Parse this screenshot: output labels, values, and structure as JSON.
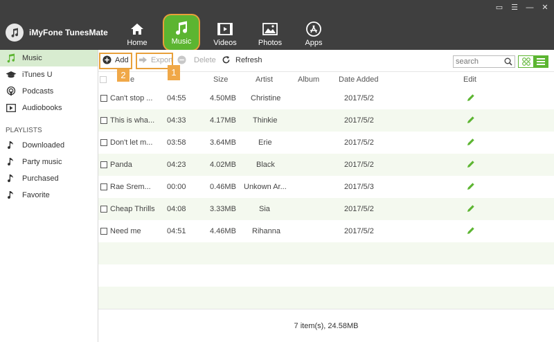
{
  "app": {
    "name": "iMyFone TunesMate"
  },
  "window_controls": {
    "feedback": "▭",
    "menu": "☰",
    "minimize": "—",
    "close": "✕"
  },
  "nav": {
    "tabs": [
      {
        "label": "Home",
        "icon": "home-icon"
      },
      {
        "label": "Music",
        "icon": "music-note-icon",
        "active": true
      },
      {
        "label": "Videos",
        "icon": "film-icon"
      },
      {
        "label": "Photos",
        "icon": "photo-icon"
      },
      {
        "label": "Apps",
        "icon": "app-store-icon"
      }
    ]
  },
  "sidebar": {
    "items": [
      {
        "label": "Music",
        "icon": "music-note-icon",
        "active": true
      },
      {
        "label": "iTunes U",
        "icon": "graduation-cap-icon"
      },
      {
        "label": "Podcasts",
        "icon": "podcast-icon"
      },
      {
        "label": "Audiobooks",
        "icon": "play-book-icon"
      }
    ],
    "playlists_heading": "PLAYLISTS",
    "playlists": [
      {
        "label": "Downloaded",
        "icon": "music-note-icon"
      },
      {
        "label": "Party music",
        "icon": "music-note-icon"
      },
      {
        "label": "Purchased",
        "icon": "music-note-icon"
      },
      {
        "label": "Favorite",
        "icon": "music-note-icon"
      }
    ]
  },
  "toolbar": {
    "add_label": "Add",
    "export_label": "Export",
    "delete_label": "Delete",
    "refresh_label": "Refresh",
    "search_placeholder": "search",
    "callout_add": "2",
    "callout_export": "1"
  },
  "table": {
    "headers": {
      "name": "e",
      "time": "",
      "size": "Size",
      "artist": "Artist",
      "album": "Album",
      "date_added": "Date Added",
      "edit": "Edit"
    },
    "rows": [
      {
        "name": "Can't stop ...",
        "time": "04:55",
        "size": "4.50MB",
        "artist": "Christine",
        "album": "",
        "date": "2017/5/2"
      },
      {
        "name": "This is wha...",
        "time": "04:33",
        "size": "4.17MB",
        "artist": "Thinkie",
        "album": "",
        "date": "2017/5/2"
      },
      {
        "name": "Don't let m...",
        "time": "03:58",
        "size": "3.64MB",
        "artist": "Erie",
        "album": "",
        "date": "2017/5/2"
      },
      {
        "name": "Panda",
        "time": "04:23",
        "size": "4.02MB",
        "artist": "Black",
        "album": "",
        "date": "2017/5/2"
      },
      {
        "name": "Rae Srem...",
        "time": "00:00",
        "size": "0.46MB",
        "artist": "Unkown Ar...",
        "album": "",
        "date": "2017/5/3"
      },
      {
        "name": "Cheap Thrills",
        "time": "04:08",
        "size": "3.33MB",
        "artist": "Sia",
        "album": "",
        "date": "2017/5/2"
      },
      {
        "name": "Need me",
        "time": "04:51",
        "size": "4.46MB",
        "artist": "Rihanna",
        "album": "",
        "date": "2017/5/2"
      }
    ]
  },
  "status": {
    "summary": "7 item(s), 24.58MB"
  },
  "colors": {
    "accent": "#5cb531",
    "header_bg": "#3f3f3f",
    "callout": "#e8a03a",
    "row_alt": "#f4f9ef",
    "sidebar_active": "#d8ecd0"
  }
}
